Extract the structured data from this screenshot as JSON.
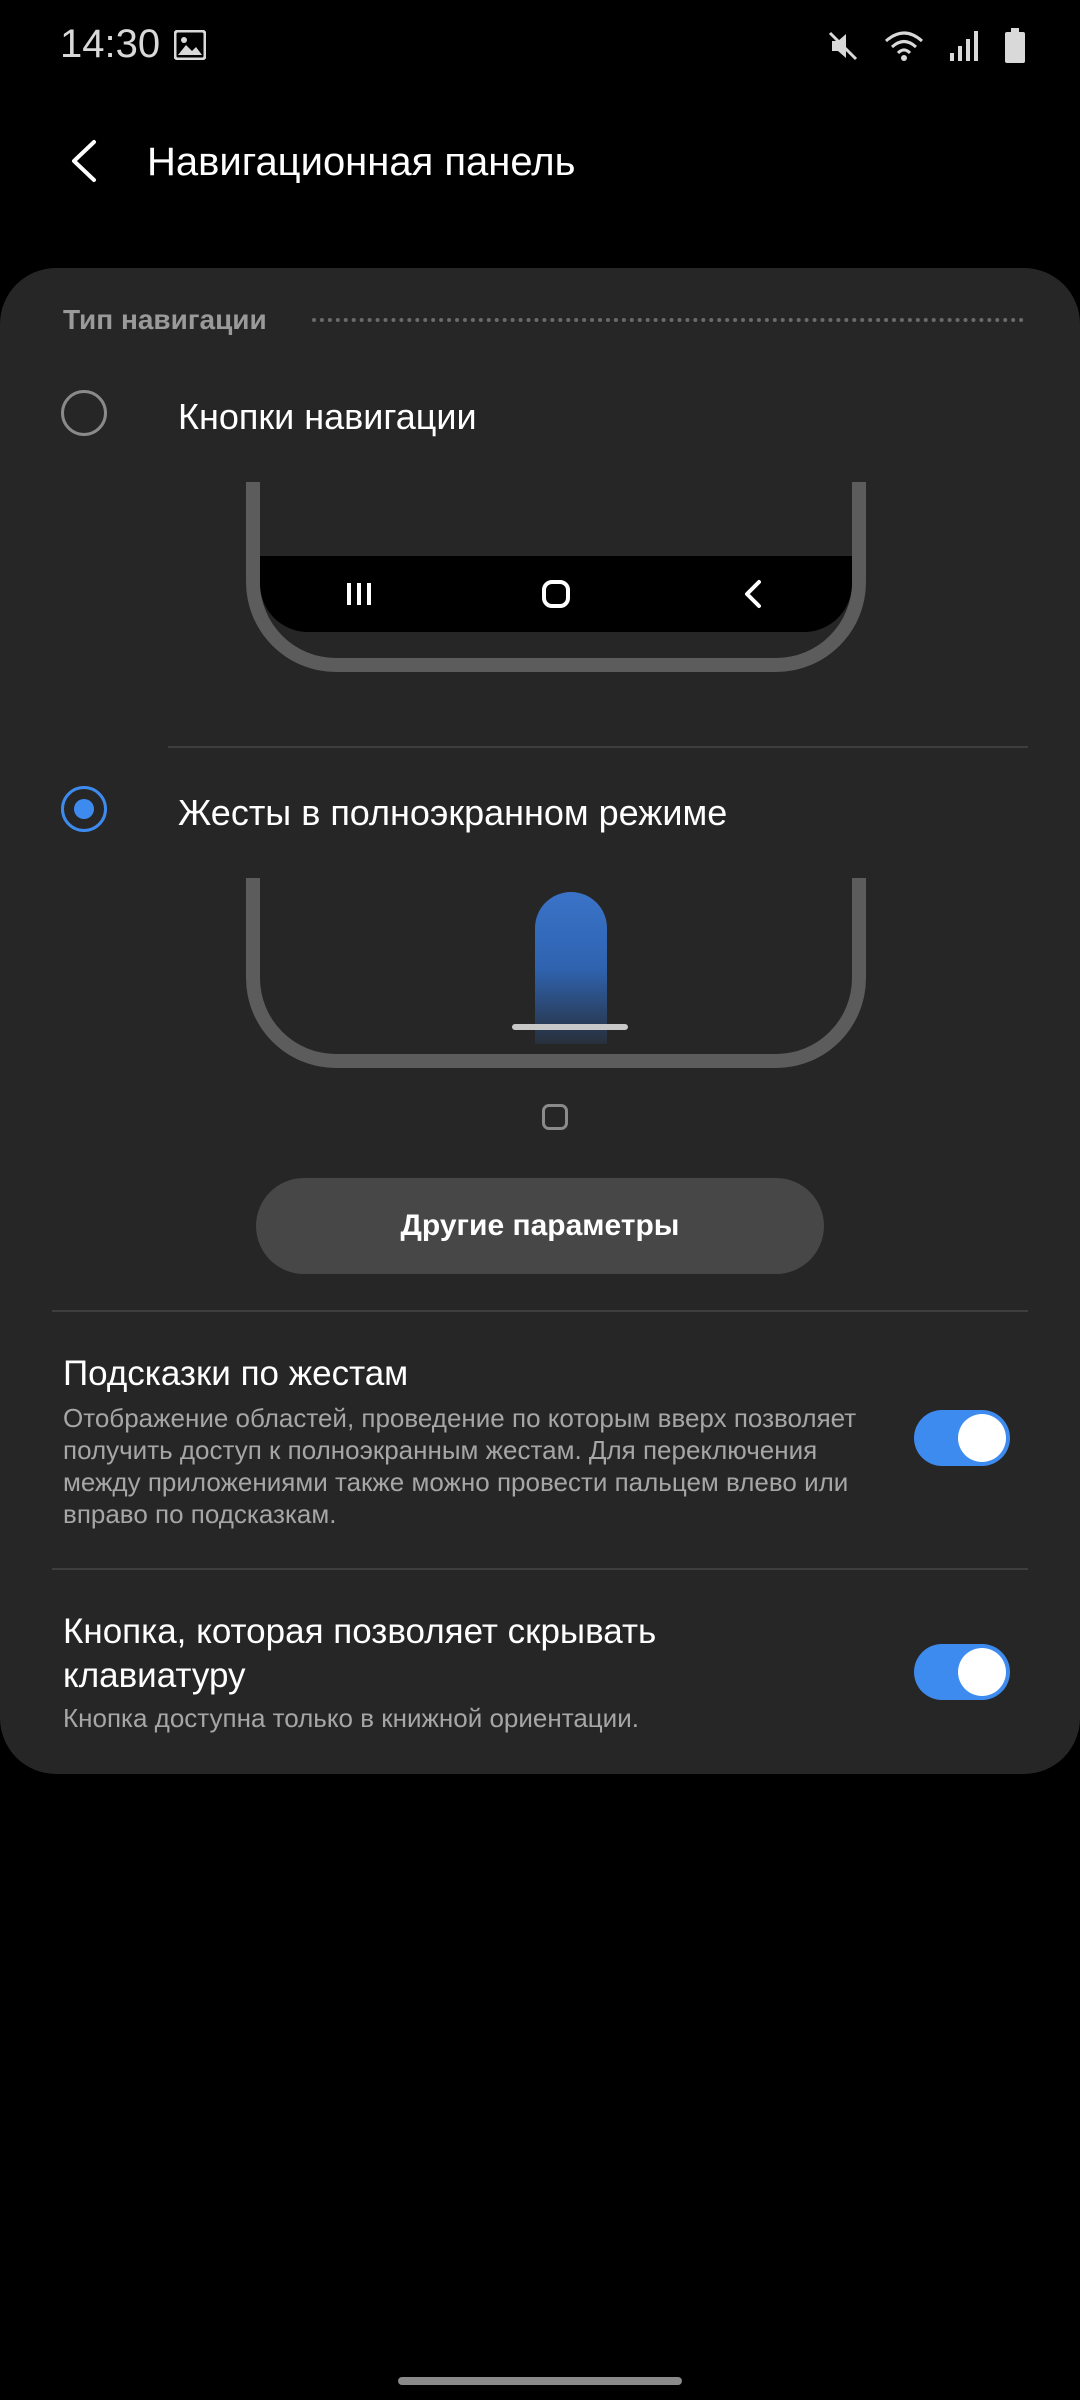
{
  "status_bar": {
    "time": "14:30",
    "icons": [
      "image-icon",
      "mute-icon",
      "wifi-icon",
      "signal-icon",
      "battery-icon"
    ]
  },
  "header": {
    "back_icon": "arrow-left-icon",
    "title": "Навигационная панель"
  },
  "navigation_type": {
    "section_title": "Тип навигации",
    "options": [
      {
        "label": "Кнопки навигации",
        "selected": false
      },
      {
        "label": "Жесты в полноэкранном режиме",
        "selected": true
      }
    ],
    "more_button": "Другие параметры"
  },
  "settings": [
    {
      "title": "Подсказки по жестам",
      "description": "Отображение областей, проведение по которым вверх позволяет получить доступ к полноэкранным жестам. Для переключения между приложениями также можно провести пальцем влево или вправо по подсказкам.",
      "enabled": true
    },
    {
      "title": "Кнопка, которая позволяет скрывать клавиатуру",
      "description": "Кнопка доступна только в книжной ориентации.",
      "enabled": true
    }
  ],
  "colors": {
    "accent": "#3e8bf0",
    "card_background": "#262626",
    "page_background": "#000000"
  }
}
